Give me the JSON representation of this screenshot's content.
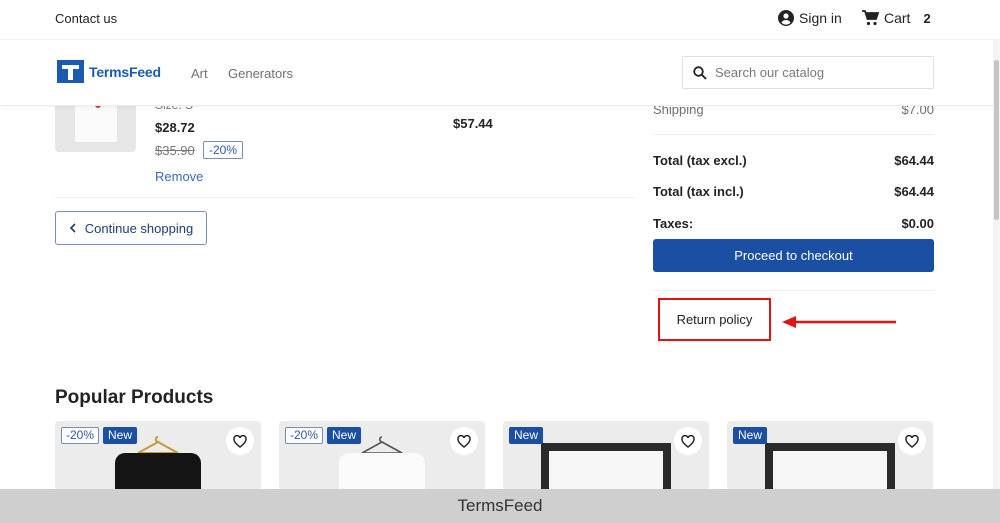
{
  "topbar": {
    "contact": "Contact us",
    "signin": "Sign in",
    "cart_label": "Cart",
    "cart_count": "2"
  },
  "header": {
    "logo": "TermsFeed",
    "nav": [
      "Art",
      "Generators"
    ],
    "search_placeholder": "Search our catalog"
  },
  "cart_item": {
    "size": "Size: S",
    "price": "$28.72",
    "old_price": "$35.90",
    "discount": "-20%",
    "remove": "Remove",
    "line_total": "$57.44"
  },
  "continue_label": "Continue shopping",
  "summary": {
    "shipping_label": "Shipping",
    "shipping_value": "$7.00",
    "total_excl_label": "Total (tax excl.)",
    "total_excl_value": "$64.44",
    "total_incl_label": "Total (tax incl.)",
    "total_incl_value": "$64.44",
    "taxes_label": "Taxes:",
    "taxes_value": "$0.00",
    "checkout": "Proceed to checkout",
    "return_policy": "Return policy"
  },
  "popular": {
    "title": "Popular Products",
    "cards": [
      {
        "discount": "-20%",
        "new": "New"
      },
      {
        "discount": "-20%",
        "new": "New"
      },
      {
        "discount": "",
        "new": "New"
      },
      {
        "discount": "",
        "new": "New"
      }
    ]
  },
  "watermark": "TermsFeed",
  "colors": {
    "primary": "#1b4fa3",
    "highlight": "#e01414",
    "logo": "#1a5bb0"
  }
}
